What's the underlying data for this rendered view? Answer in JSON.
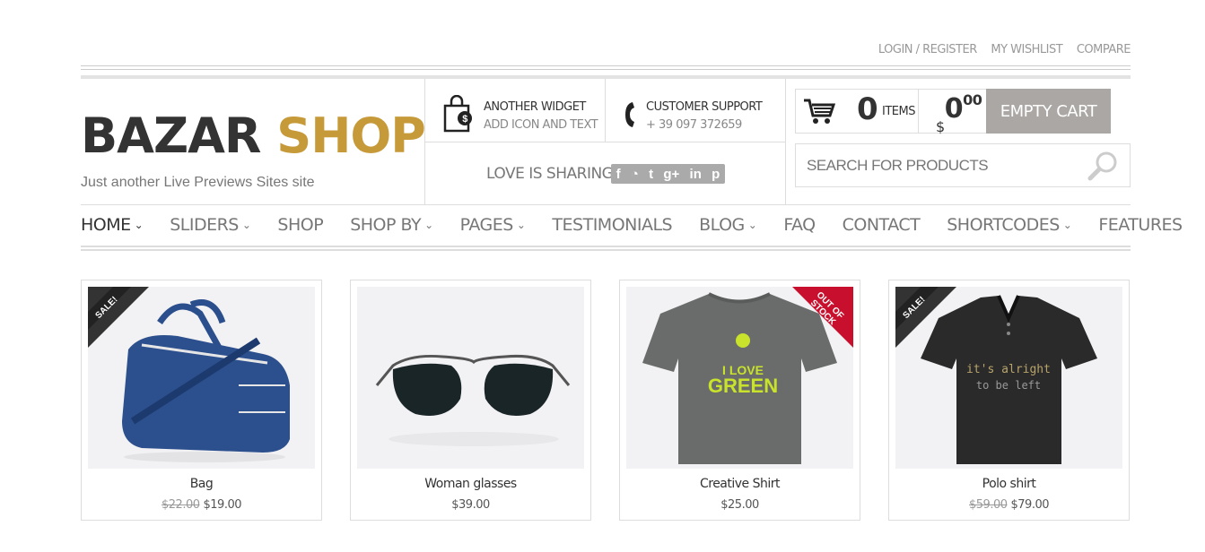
{
  "toplinks": {
    "login": "LOGIN / REGISTER",
    "wishlist": "MY WISHLIST",
    "compare": "COMPARE"
  },
  "logo": {
    "part1": "BAZAR",
    "part2": "SHOP",
    "accent_color": "#c69a39"
  },
  "tagline": "Just another Live Previews Sites site",
  "widgets": {
    "another": {
      "title": "ANOTHER WIDGET",
      "sub": "ADD ICON AND TEXT"
    },
    "support": {
      "title": "CUSTOMER SUPPORT",
      "sub": "+ 39 097 372659"
    }
  },
  "sharing": {
    "label": "LOVE IS SHARING",
    "icons": {
      "facebook": "f",
      "rss": "ʕ",
      "twitter": "t",
      "googleplus": "g+",
      "linkedin": "in",
      "pinterest": "p"
    }
  },
  "cart": {
    "count": "0",
    "items_label": "ITEMS",
    "currency": "$",
    "amount": "0",
    "decimals": "00",
    "empty_label": "EMPTY CART",
    "button_color": "#aba7a4"
  },
  "search": {
    "placeholder": "SEARCH FOR PRODUCTS"
  },
  "nav": [
    {
      "label": "HOME",
      "dropdown": true,
      "active": true
    },
    {
      "label": "SLIDERS",
      "dropdown": true
    },
    {
      "label": "SHOP",
      "dropdown": false
    },
    {
      "label": "SHOP BY",
      "dropdown": true
    },
    {
      "label": "PAGES",
      "dropdown": true
    },
    {
      "label": "TESTIMONIALS",
      "dropdown": false
    },
    {
      "label": "BLOG",
      "dropdown": true
    },
    {
      "label": "FAQ",
      "dropdown": false
    },
    {
      "label": "CONTACT",
      "dropdown": false
    },
    {
      "label": "SHORTCODES",
      "dropdown": true
    },
    {
      "label": "FEATURES",
      "dropdown": false
    }
  ],
  "products": [
    {
      "name": "Bag",
      "old_price": "$22.00",
      "price": "$19.00",
      "badge": "SALE!"
    },
    {
      "name": "Woman glasses",
      "old_price": "",
      "price": "$39.00",
      "badge": ""
    },
    {
      "name": "Creative Shirt",
      "old_price": "",
      "price": "$25.00",
      "badge": "OUT OF STOCK",
      "shirt_text_1": "I LOVE",
      "shirt_text_2": "GREEN"
    },
    {
      "name": "Polo shirt",
      "old_price": "$59.00",
      "price": "$79.00",
      "badge": "SALE!",
      "shirt_text_1": "it's alright",
      "shirt_text_2": "to be left"
    }
  ]
}
